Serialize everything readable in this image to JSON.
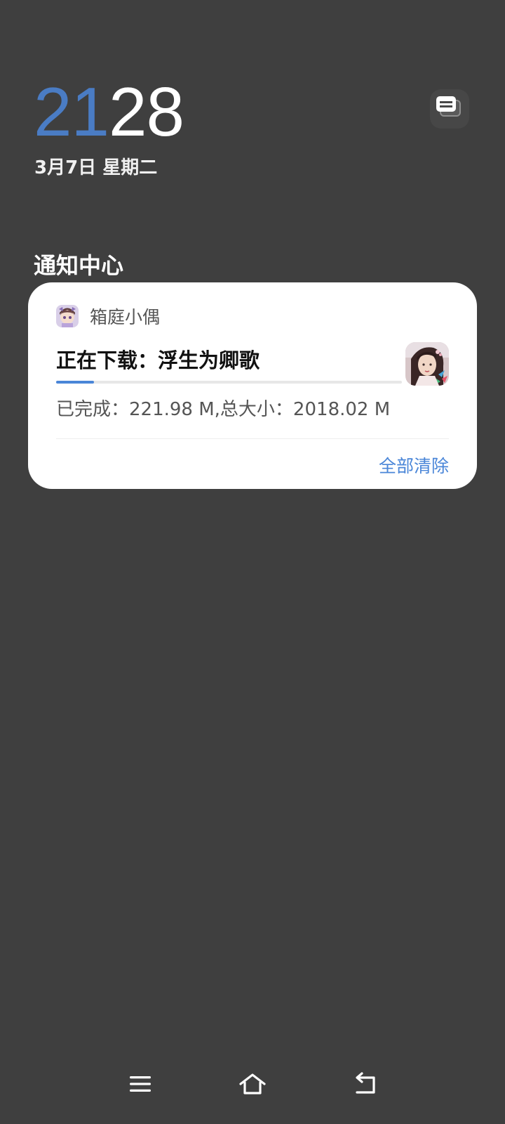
{
  "lockscreen": {
    "clock_hours": "21",
    "clock_minutes": "28",
    "date": "3月7日 星期二",
    "accent_color": "#4a7cc4"
  },
  "notification_center": {
    "title": "通知中心",
    "manage_icon": "notification-manage-icon"
  },
  "notification": {
    "app_name": "箱庭小偶",
    "app_icon": "app-avatar-icon",
    "title": "正在下载：浮生为卿歌",
    "progress_fraction": 0.11,
    "progress_text": "已完成：221.98 M,总大小：2018.02 M",
    "thumbnail": "game-thumbnail-image",
    "clear_all_label": "全部清除",
    "accent_color": "#4a86d8"
  },
  "navbar": {
    "menu_icon": "menu-icon",
    "home_icon": "home-icon",
    "back_icon": "back-icon"
  }
}
